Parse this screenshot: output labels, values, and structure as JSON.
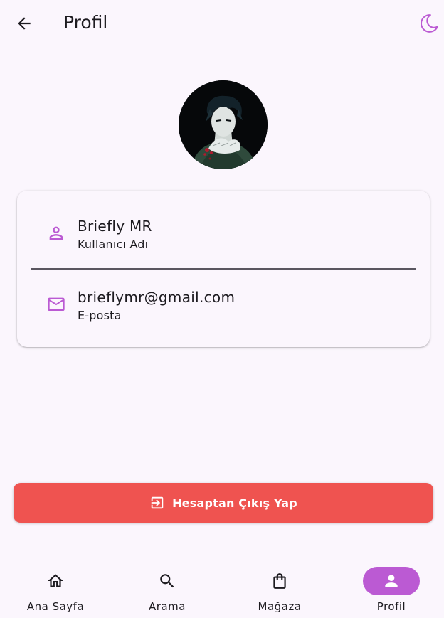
{
  "appbar": {
    "title": "Profil",
    "back_icon": "arrow-left-icon",
    "theme_icon": "moon-icon"
  },
  "profile": {
    "avatar_icon": "profile-photo",
    "username": {
      "value": "Briefly MR",
      "label": "Kullanıcı Adı",
      "icon": "person-outline-icon"
    },
    "email": {
      "value": "brieflymr@gmail.com",
      "label": "E-posta",
      "icon": "mail-outline-icon"
    }
  },
  "logout": {
    "label": "Hesaptan Çıkış Yap",
    "icon": "logout-icon",
    "color": "#ef5350"
  },
  "bottom_nav": {
    "active": "Profil",
    "items": [
      {
        "label": "Ana Sayfa",
        "icon": "home-icon"
      },
      {
        "label": "Arama",
        "icon": "search-icon"
      },
      {
        "label": "Mağaza",
        "icon": "shopping-bag-icon"
      },
      {
        "label": "Profil",
        "icon": "person-icon"
      }
    ]
  },
  "colors": {
    "background": "#fbf6fd",
    "accent": "#bb5ad3",
    "danger": "#ef5350",
    "text": "#1d1b20"
  }
}
